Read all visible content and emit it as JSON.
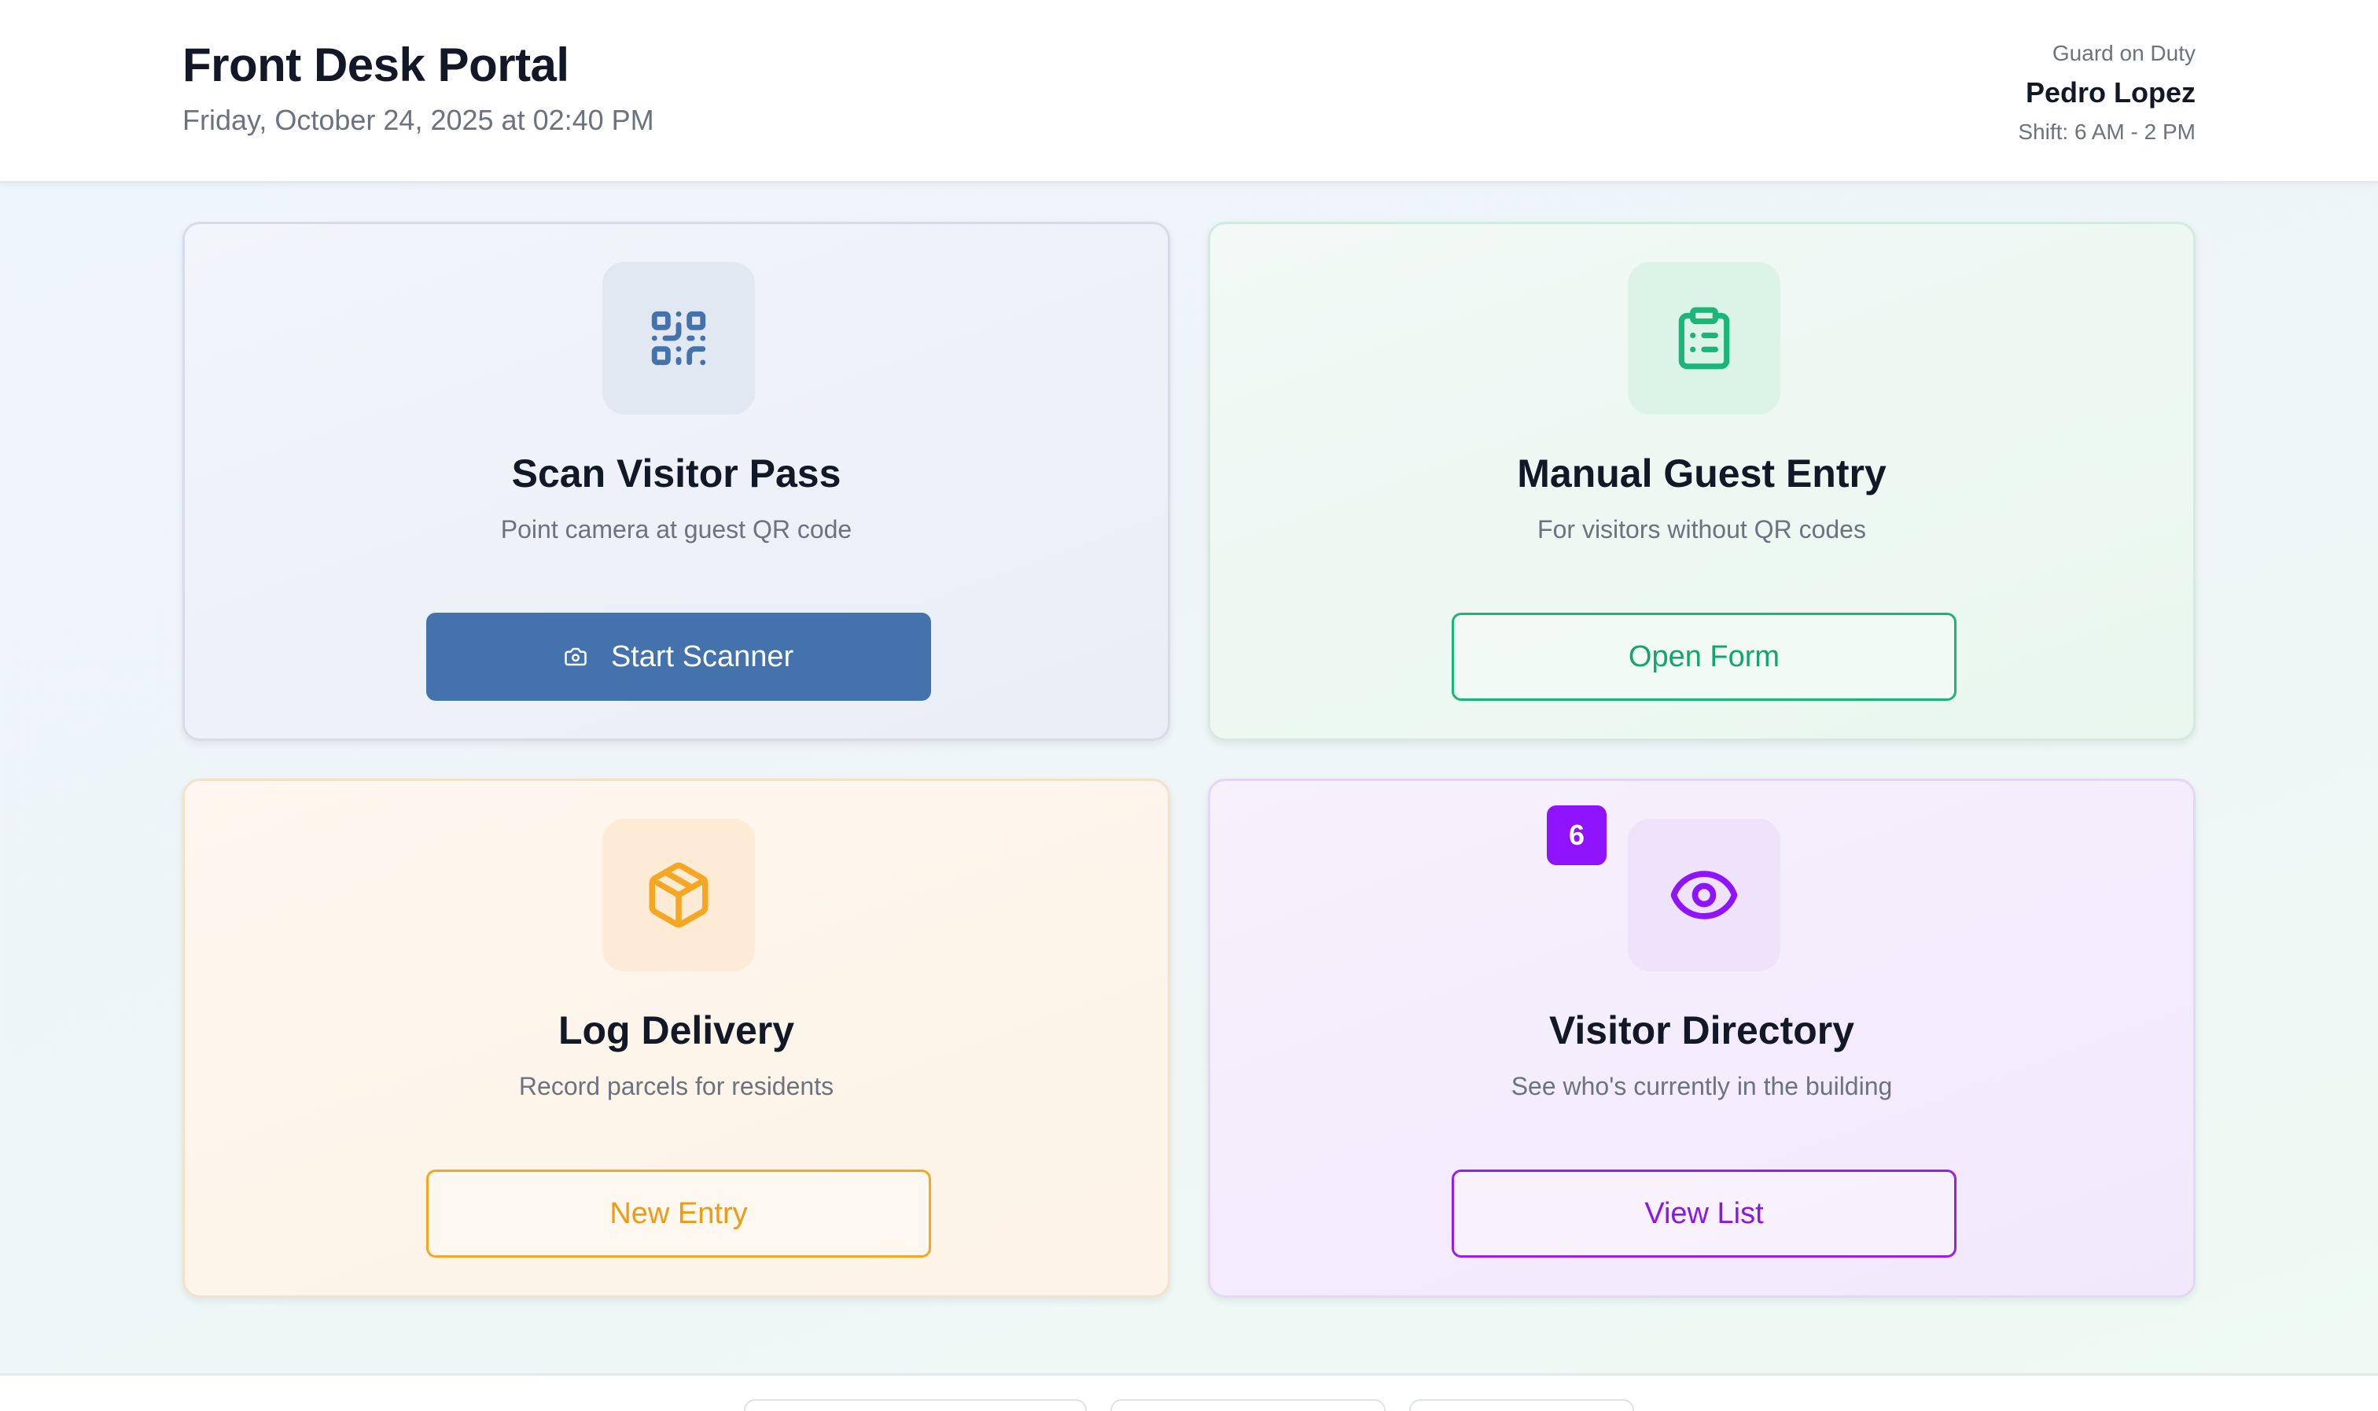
{
  "header": {
    "title": "Front Desk Portal",
    "datetime": "Friday, October 24, 2025 at 02:40 PM",
    "guard_label": "Guard on Duty",
    "guard_name": "Pedro Lopez",
    "shift": "Shift: 6 AM - 2 PM"
  },
  "cards": {
    "scan": {
      "icon": "qr-code-icon",
      "title": "Scan Visitor Pass",
      "description": "Point camera at guest QR code",
      "button_icon": "camera-icon",
      "button_label": "Start Scanner",
      "accent": "#4472ad"
    },
    "manual": {
      "icon": "clipboard-list-icon",
      "title": "Manual Guest Entry",
      "description": "For visitors without QR codes",
      "button_label": "Open Form",
      "accent": "#1bb578"
    },
    "delivery": {
      "icon": "package-icon",
      "title": "Log Delivery",
      "description": "Record parcels for residents",
      "button_label": "New Entry",
      "accent": "#f5a623"
    },
    "directory": {
      "icon": "eye-icon",
      "title": "Visitor Directory",
      "description": "See who's currently in the building",
      "badge_count": "6",
      "button_label": "View List",
      "accent": "#9013fe"
    }
  }
}
